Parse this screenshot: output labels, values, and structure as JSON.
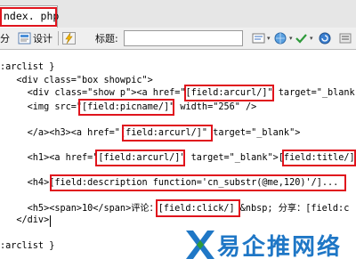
{
  "tab": {
    "filename": "ndex. php"
  },
  "toolbar": {
    "split_label": "分",
    "design_label": "设计",
    "title_label": "标题:"
  },
  "code_lines": [
    ":arclist }",
    "   <div class=\"box showpic\">",
    "     <div class=\"show p\"><a href=\"[field:arcurl/]\" target=\"_blank",
    "     <img src=\"[field:picname/]\" width=\"256\" />",
    "",
    "     </a><h3><a href=\"[field:arcurl/]\" target=\"_blank\">",
    "",
    "     <h1><a href=\"[field:arcurl/]\" target=\"_blank\">[field:title/]",
    "",
    "     <h4>[field:description function='cn_substr(@me,120)'/]...",
    "",
    "     <h5><span>10</span>评论：[field:click/] &nbsp; 分享：[field:c",
    "   </div>",
    "",
    ":arclist }"
  ],
  "watermark": {
    "text": "易企推网络"
  },
  "colors": {
    "highlight_box": "#e0141d",
    "watermark_blue": "#1f77c6",
    "watermark_green": "#2e9a3a"
  }
}
